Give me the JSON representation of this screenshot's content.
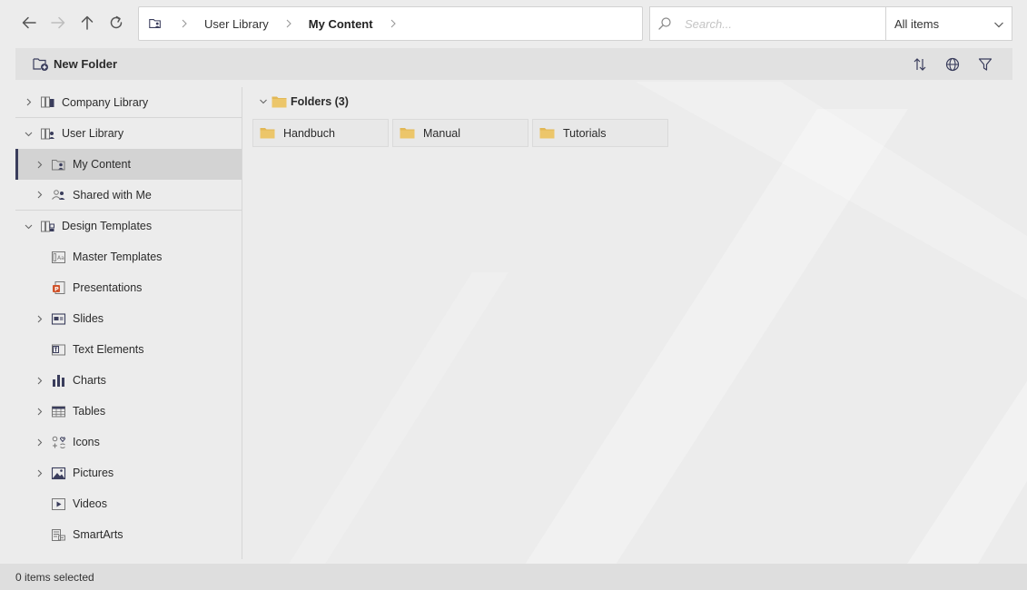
{
  "nav": {
    "back_icon": "arrow-left-icon",
    "forward_icon": "arrow-right-icon",
    "up_icon": "arrow-up-icon",
    "refresh_icon": "refresh-icon"
  },
  "breadcrumb": {
    "items": [
      "User Library",
      "My Content"
    ]
  },
  "search": {
    "placeholder": "Search..."
  },
  "filter": {
    "selected": "All items"
  },
  "toolbar": {
    "new_folder_label": "New Folder",
    "sort_icon": "sort-icon",
    "globe_icon": "globe-icon",
    "filter_icon": "filter-icon"
  },
  "tree": {
    "items": [
      {
        "label": "Company Library",
        "level": 0,
        "expander": "collapsed",
        "icon": "company-library-icon"
      },
      {
        "label": "User Library",
        "level": 0,
        "expander": "expanded",
        "icon": "user-library-icon"
      },
      {
        "label": "My Content",
        "level": 1,
        "expander": "collapsed",
        "icon": "my-content-icon",
        "selected": true
      },
      {
        "label": "Shared with Me",
        "level": 1,
        "expander": "collapsed",
        "icon": "shared-icon"
      },
      {
        "label": "Design Templates",
        "level": 0,
        "expander": "expanded",
        "icon": "design-templates-icon"
      },
      {
        "label": "Master Templates",
        "level": 1,
        "expander": "none",
        "icon": "master-templates-icon"
      },
      {
        "label": "Presentations",
        "level": 1,
        "expander": "none",
        "icon": "presentations-icon"
      },
      {
        "label": "Slides",
        "level": 1,
        "expander": "collapsed",
        "icon": "slides-icon"
      },
      {
        "label": "Text Elements",
        "level": 1,
        "expander": "none",
        "icon": "text-elements-icon"
      },
      {
        "label": "Charts",
        "level": 1,
        "expander": "collapsed",
        "icon": "charts-icon"
      },
      {
        "label": "Tables",
        "level": 1,
        "expander": "collapsed",
        "icon": "tables-icon"
      },
      {
        "label": "Icons",
        "level": 1,
        "expander": "collapsed",
        "icon": "icons-icon"
      },
      {
        "label": "Pictures",
        "level": 1,
        "expander": "collapsed",
        "icon": "pictures-icon"
      },
      {
        "label": "Videos",
        "level": 1,
        "expander": "none",
        "icon": "videos-icon"
      },
      {
        "label": "SmartArts",
        "level": 1,
        "expander": "none",
        "icon": "smartarts-icon"
      }
    ]
  },
  "content": {
    "group_label": "Folders (3)",
    "folders": [
      "Handbuch",
      "Manual",
      "Tutorials"
    ]
  },
  "status": {
    "text": "0 items selected"
  },
  "colors": {
    "accent": "#3a3d5c",
    "folder": "#e2b856",
    "selected_bg": "#d3d3d3",
    "toolbar_bg": "#e1e1e1"
  }
}
